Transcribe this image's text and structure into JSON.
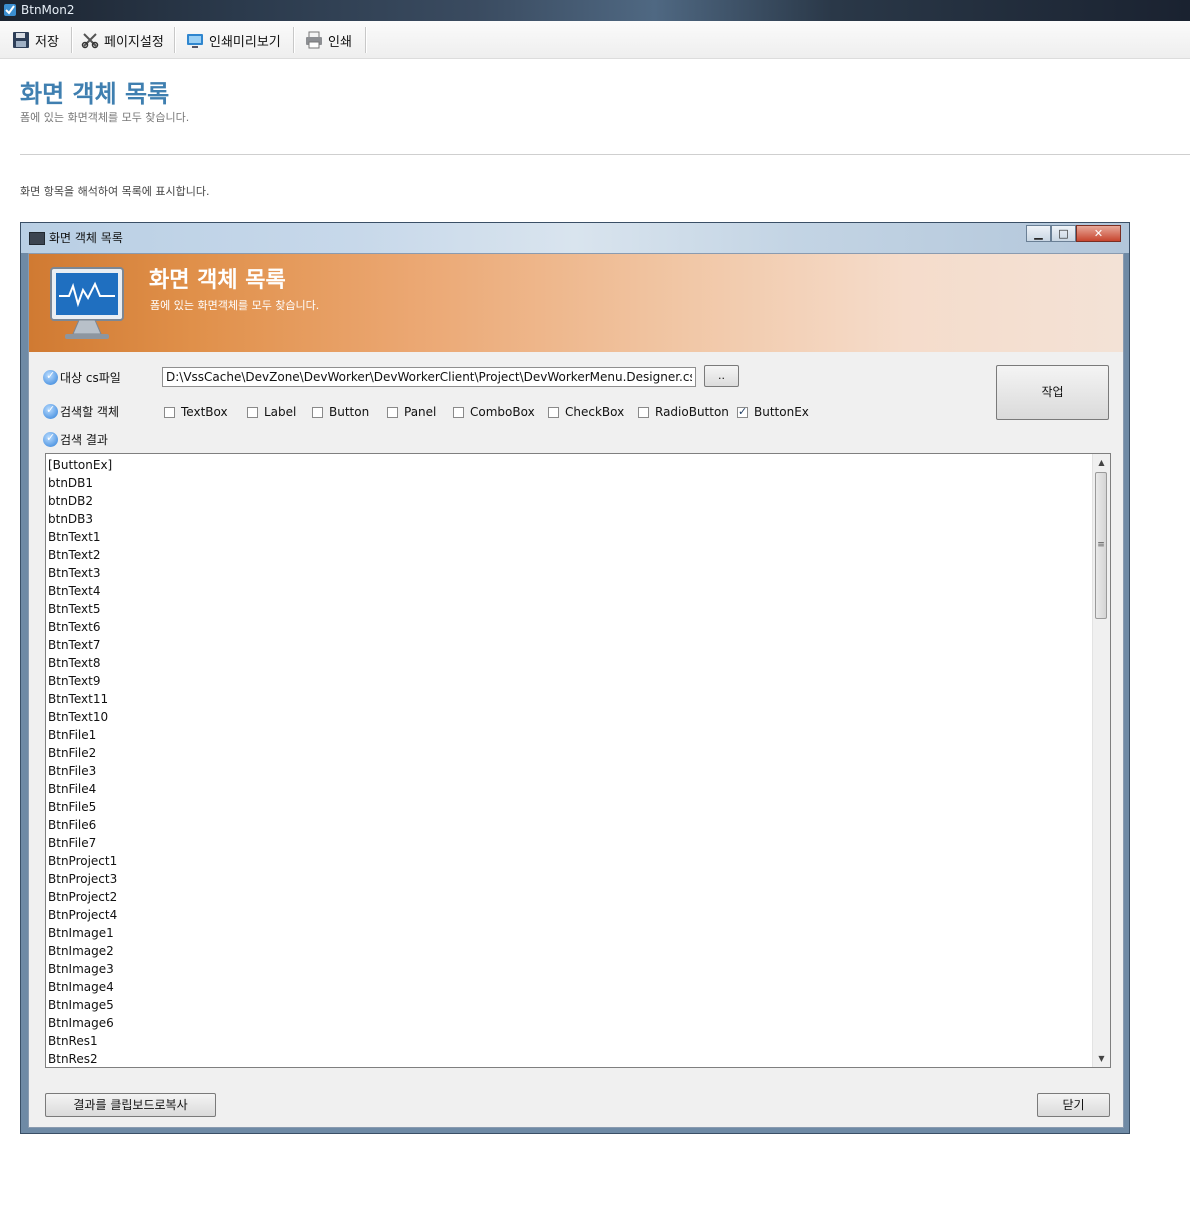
{
  "app": {
    "title": "BtnMon2"
  },
  "toolbar": {
    "save_label": "저장",
    "page_setup_label": "페이지설정",
    "print_preview_label": "인쇄미리보기",
    "print_label": "인쇄"
  },
  "page": {
    "title": "화면 객체 목록",
    "subtitle": "폼에 있는 화면객체를 모두 찾습니다.",
    "description": "화면 항목을 해석하여 목록에 표시합니다."
  },
  "dialog": {
    "caption": "화면 객체 목록",
    "banner_title": "화면 객체 목록",
    "banner_subtitle": "폼에 있는 화면객체를 모두 찾습니다.",
    "target_label": "대상 cs파일",
    "target_value": "D:\\VssCache\\DevZone\\DevWorker\\DevWorkerClient\\Project\\DevWorkerMenu.Designer.cs",
    "browse_label": "..",
    "run_label": "작업",
    "search_type_label": "검색할 객체",
    "result_label": "검색 결과",
    "copy_label": "결과를 클립보드로복사",
    "close_label": "닫기",
    "checkboxes": [
      {
        "label": "TextBox",
        "checked": false
      },
      {
        "label": "Label",
        "checked": false
      },
      {
        "label": "Button",
        "checked": false
      },
      {
        "label": "Panel",
        "checked": false
      },
      {
        "label": "ComboBox",
        "checked": false
      },
      {
        "label": "CheckBox",
        "checked": false
      },
      {
        "label": "RadioButton",
        "checked": false
      },
      {
        "label": "ButtonEx",
        "checked": true
      }
    ],
    "results": [
      "[ButtonEx]",
      "btnDB1",
      "btnDB2",
      "btnDB3",
      "BtnText1",
      "BtnText2",
      "BtnText3",
      "BtnText4",
      "BtnText5",
      "BtnText6",
      "BtnText7",
      "BtnText8",
      "BtnText9",
      "BtnText11",
      "BtnText10",
      "BtnFile1",
      "BtnFile2",
      "BtnFile3",
      "BtnFile4",
      "BtnFile5",
      "BtnFile6",
      "BtnFile7",
      "BtnProject1",
      "BtnProject3",
      "BtnProject2",
      "BtnProject4",
      "BtnImage1",
      "BtnImage2",
      "BtnImage3",
      "BtnImage4",
      "BtnImage5",
      "BtnImage6",
      "BtnRes1",
      "BtnRes2"
    ]
  },
  "icons": {
    "app": "app-icon",
    "save": "floppy-disk-icon",
    "page_setup": "scissors-tools-icon",
    "print_preview": "monitor-preview-icon",
    "print": "printer-icon",
    "banner": "monitor-chart-icon",
    "info": "check-badge-icon"
  },
  "colors": {
    "heading": "#3f7fb0",
    "banner_start": "#d07a32",
    "banner_end": "#f3e2d6"
  }
}
